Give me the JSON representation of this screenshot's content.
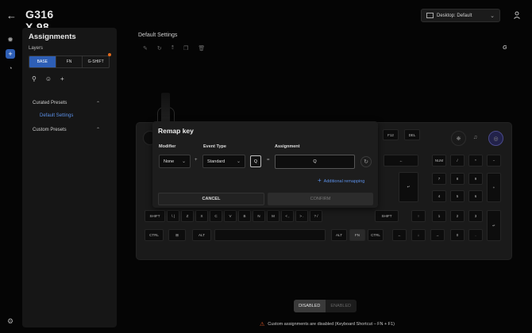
{
  "app": {
    "title": "G316 X 98",
    "profile": "Desktop: Default"
  },
  "colors": {
    "accent": "#2e5fb6",
    "link": "#5b8fe6",
    "warning": "#e05a2a",
    "orange_dot": "#e36a1c"
  },
  "sidebar": {
    "title": "Assignments",
    "layers_label": "Layers",
    "layers": [
      "BASE",
      "FN",
      "G-SHIFT"
    ],
    "active_layer": "BASE",
    "sections": [
      {
        "label": "Curated Presets",
        "items": [
          "Default Settings"
        ]
      },
      {
        "label": "Custom Presets",
        "items": []
      }
    ]
  },
  "main": {
    "title": "Default Settings",
    "brand_mark": "G"
  },
  "keyboard": {
    "row_fn": [
      "F12",
      "DEL"
    ],
    "row_num": [
      "←",
      "NUM",
      "/",
      "*",
      "−"
    ],
    "row_q": [
      "7",
      "8",
      "9"
    ],
    "row_a": [
      "4",
      "5",
      "6",
      "+"
    ],
    "row_z_left": [
      "SHIFT",
      "\\ |",
      "Z",
      "X",
      "C",
      "V",
      "B",
      "N",
      "M",
      "< ,",
      "> .",
      "? /"
    ],
    "row_z_right": [
      "SHIFT",
      "↑",
      "1",
      "2",
      "3"
    ],
    "row_ctrl_left": [
      "CTRL",
      "⊞",
      "ALT"
    ],
    "row_ctrl_right": [
      "ALT",
      "FN",
      "CTRL",
      "←",
      "↓",
      "→",
      "0",
      ".",
      "↵"
    ],
    "enter_glyph": "↵"
  },
  "modal": {
    "title": "Remap key",
    "modifier_label": "Modifier",
    "modifier_value": "None",
    "event_type_label": "Event Type",
    "event_type_value": "Standard",
    "plus": "+",
    "key_value": "Q",
    "equals": "=",
    "assignment_label": "Assignment",
    "assignment_value": "Q",
    "additional_remapping": "Additional remapping",
    "cancel": "CANCEL",
    "confirm": "CONFIRM"
  },
  "footer": {
    "toggle": [
      "DISABLED",
      "ENABLED"
    ],
    "toggle_selected": "DISABLED",
    "warning": "Custom assignments are disabled (Keyboard Shortcut – FN + F1)"
  }
}
